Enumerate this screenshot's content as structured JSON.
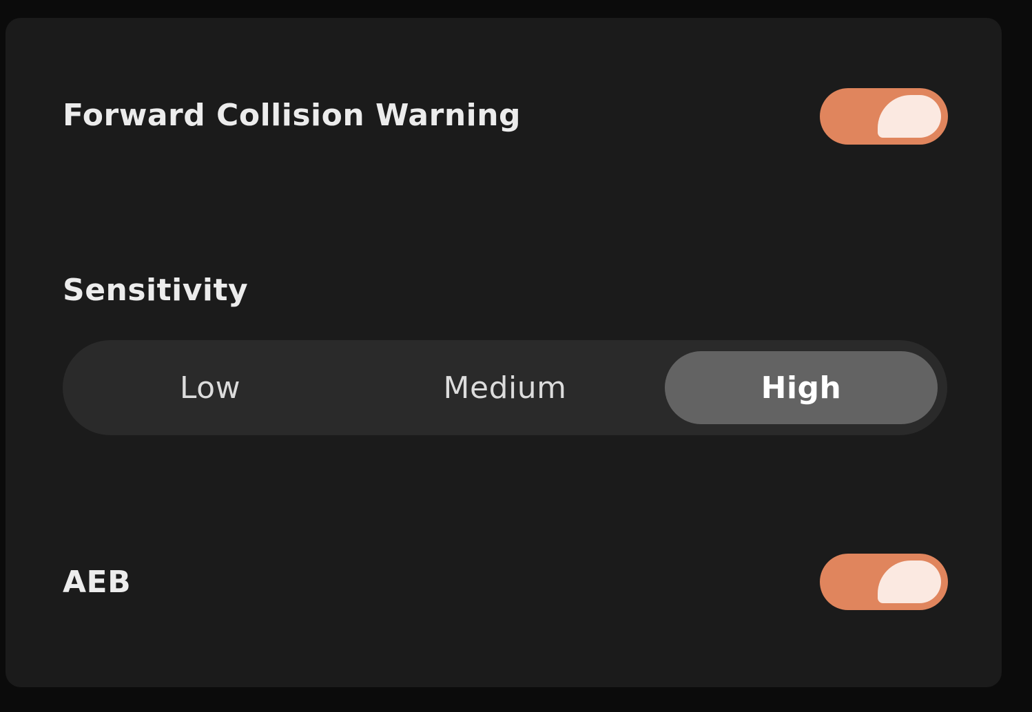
{
  "settings": {
    "fcw": {
      "label": "Forward Collision Warning",
      "enabled": true
    },
    "sensitivity": {
      "label": "Sensitivity",
      "options": [
        "Low",
        "Medium",
        "High"
      ],
      "selected": "High"
    },
    "aeb": {
      "label": "AEB",
      "enabled": true
    }
  },
  "colors": {
    "accent": "#e0855d",
    "knob": "#fbe9e1",
    "panel": "#1b1b1b",
    "segment_track": "#2a2a2a",
    "segment_active": "#636363"
  }
}
